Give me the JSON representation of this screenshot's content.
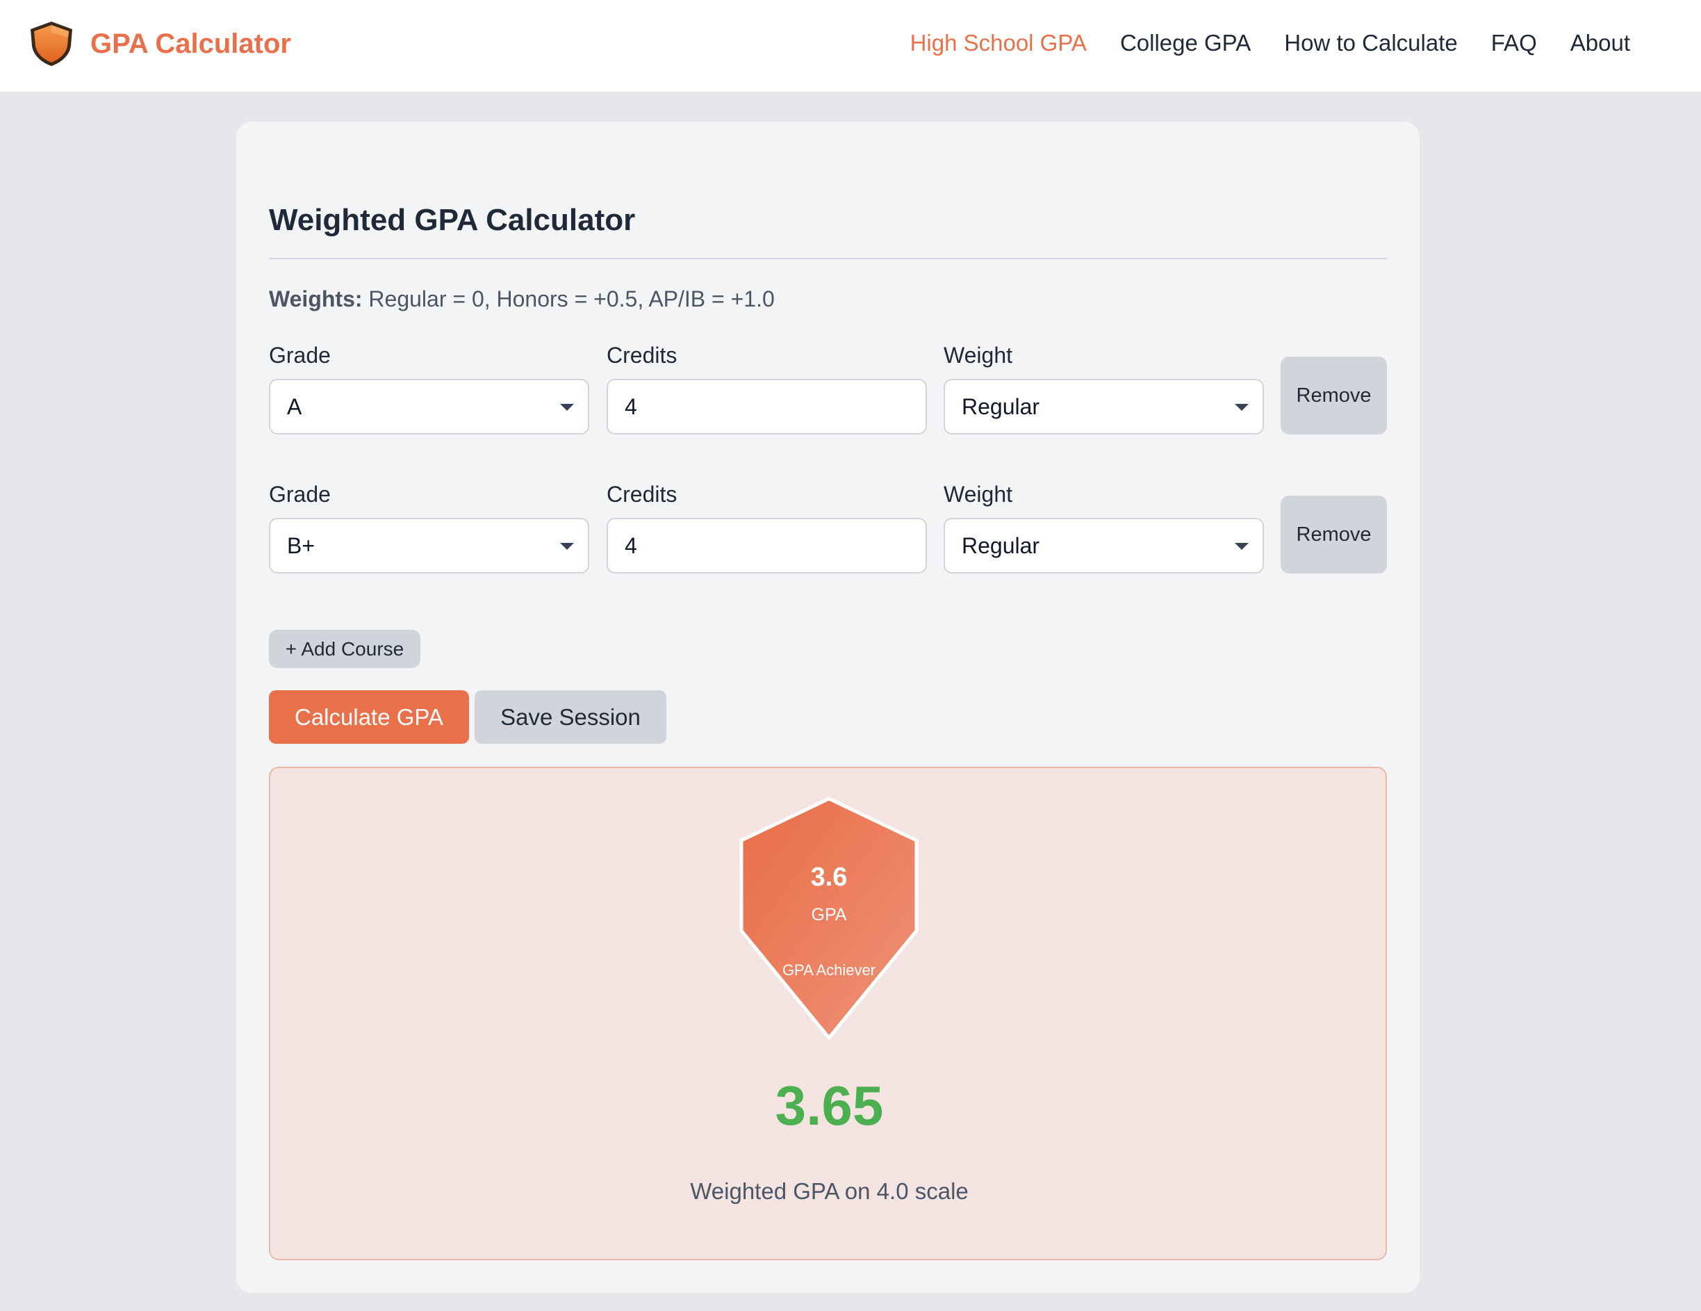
{
  "brand": {
    "name": "GPA Calculator",
    "icon": "shield-icon",
    "color": "#e8704a"
  },
  "nav": {
    "items": [
      {
        "label": "High School GPA",
        "active": true
      },
      {
        "label": "College GPA",
        "active": false
      },
      {
        "label": "How to Calculate",
        "active": false
      },
      {
        "label": "FAQ",
        "active": false
      },
      {
        "label": "About",
        "active": false
      }
    ]
  },
  "calculator": {
    "title": "Weighted GPA Calculator",
    "weights_label": "Weights:",
    "weights_text": " Regular = 0, Honors = +0.5, AP/IB = +1.0",
    "labels": {
      "grade": "Grade",
      "credits": "Credits",
      "weight": "Weight",
      "remove": "Remove"
    },
    "courses": [
      {
        "grade": "A",
        "credits": "4",
        "weight": "Regular"
      },
      {
        "grade": "B+",
        "credits": "4",
        "weight": "Regular"
      }
    ],
    "add_course_label": "+ Add Course",
    "calculate_label": "Calculate GPA",
    "save_label": "Save Session"
  },
  "result": {
    "badge_value": "3.6",
    "badge_unit": "GPA",
    "badge_caption": "GPA Achiever",
    "gpa": "3.65",
    "description": "Weighted GPA on 4.0 scale",
    "gpa_color": "#4caf50"
  }
}
